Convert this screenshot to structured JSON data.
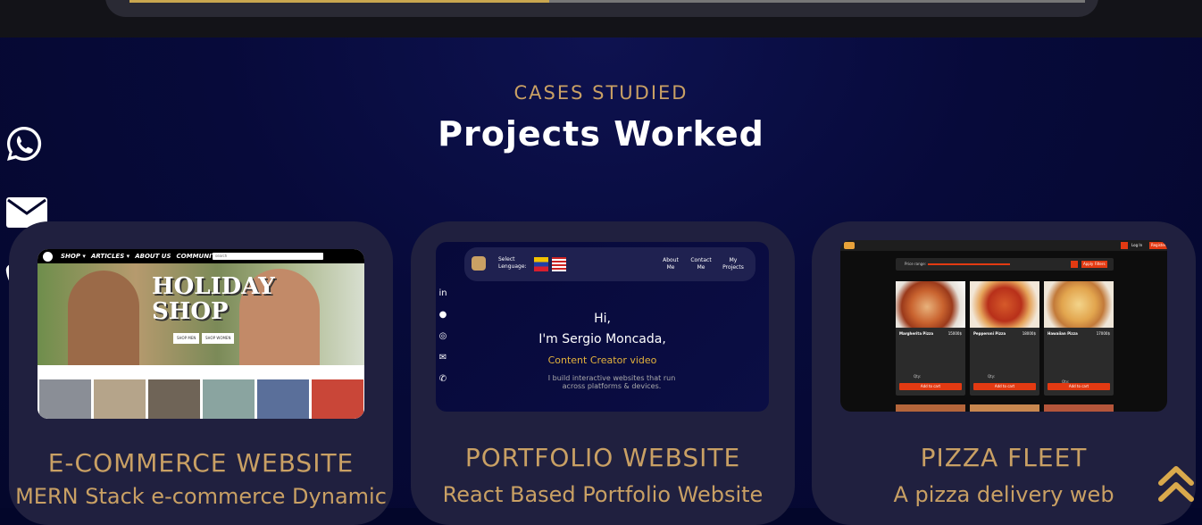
{
  "section": {
    "subtitle": "CASES STUDIED",
    "title": "Projects Worked"
  },
  "side_icons": [
    "whatsapp-icon",
    "email-icon",
    "phone-icon"
  ],
  "projects": [
    {
      "title": "E-COMMERCE WEBSITE",
      "description": "MERN Stack e-commerce Dynamic",
      "preview": {
        "nav": [
          "SHOP ▾",
          "ARTICLES ▾",
          "ABOUT US",
          "COMMUNITY"
        ],
        "search_placeholder": "search",
        "hero_title": "HOLIDAY SHOP",
        "buttons": [
          "SHOP MEN",
          "SHOP WOMEN"
        ]
      }
    },
    {
      "title": "PORTFOLIO WEBSITE",
      "description": "React Based Portfolio Website",
      "preview": {
        "select_language": "Select Lenguage:",
        "nav": [
          "About Me",
          "Contact Me",
          "My Projects"
        ],
        "greeting": "Hi,",
        "intro": "I'm Sergio Moncada,",
        "role": "Content Creator video",
        "tagline": "I build interactive websites that run across platforms & devices."
      }
    },
    {
      "title": "PIZZA FLEET",
      "description": "A pizza delivery web",
      "preview": {
        "filter_label": "Price range:",
        "filter_button": "Apply Filters",
        "header_links": [
          "Log In",
          "Register"
        ],
        "pizzas": [
          {
            "name": "Margherita Pizza",
            "price": "15000$"
          },
          {
            "name": "Pepperoni Pizza",
            "price": "18000$"
          },
          {
            "name": "Hawaiian Pizza",
            "price": "17000$"
          }
        ],
        "qty_label": "Qty:",
        "add_to_cart": "Add to cart"
      }
    }
  ],
  "colors": {
    "accent": "#c9a064",
    "background": "#04072c",
    "card": "#20203f"
  }
}
